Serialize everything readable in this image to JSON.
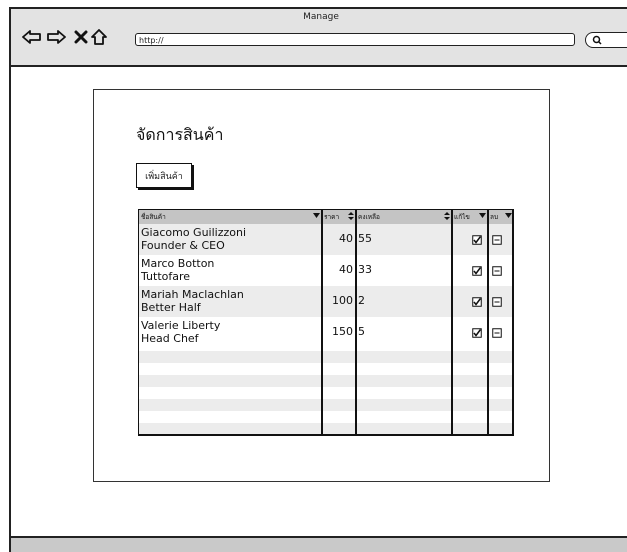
{
  "window": {
    "title": "Manage"
  },
  "browser": {
    "url": "http://"
  },
  "page": {
    "title": "จัดการสินค้า",
    "add_button": "เพิ่มสินค้า"
  },
  "table": {
    "columns": [
      "ชื่อสินค้า",
      "ราคา",
      "คงเหลือ",
      "แก้ไข",
      "ลบ"
    ],
    "rows": [
      {
        "name1": "Giacomo Guilizzoni",
        "name2": "Founder & CEO",
        "price": "40",
        "stock": "55"
      },
      {
        "name1": "Marco Botton",
        "name2": "Tuttofare",
        "price": "40",
        "stock": "33"
      },
      {
        "name1": "Mariah Maclachlan",
        "name2": "Better Half",
        "price": "100",
        "stock": "2"
      },
      {
        "name1": "Valerie Liberty",
        "name2": "Head Chef",
        "price": "150",
        "stock": "5"
      }
    ]
  },
  "icons": {
    "back": "left-arrow-icon",
    "forward": "right-arrow-icon",
    "stop": "x-icon",
    "home": "home-icon",
    "search": "search-icon",
    "edit": "checkbox-icon",
    "delete": "minus-box-icon"
  },
  "colors": {
    "chrome": "#e3e3e3",
    "header": "#c4c4c4",
    "row_alt": "#ececec",
    "status": "#c9c9c9"
  }
}
